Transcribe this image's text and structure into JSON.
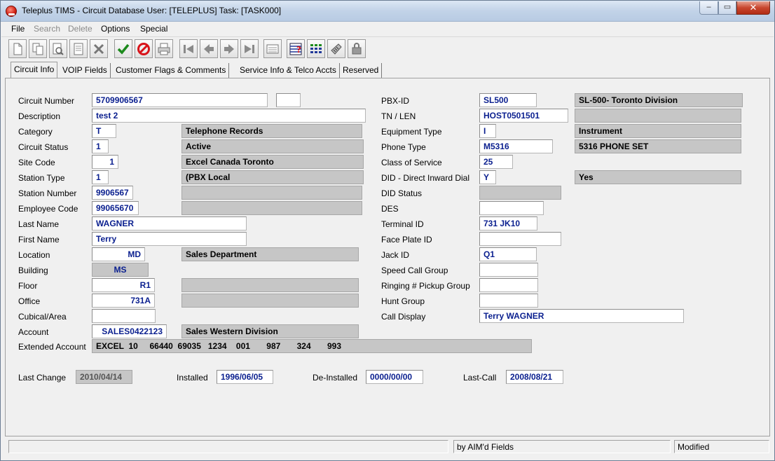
{
  "window": {
    "title": "Teleplus TIMS - Circuit Database  User: [TELEPLUS]  Task: [TASK000]",
    "minimize": "‒",
    "maximize": "▭",
    "close": "✕"
  },
  "menu": [
    "File",
    "Search",
    "Delete",
    "Options",
    "Special"
  ],
  "toolbar": {
    "icons": [
      "new-icon",
      "copy-icon",
      "find-icon",
      "print-preview-icon",
      "delete-icon",
      "accept-icon",
      "cancel-icon",
      "printer-icon",
      "first-record-icon",
      "previous-record-icon",
      "next-record-icon",
      "last-record-icon",
      "list-icon",
      "query-icon",
      "grid-icon",
      "phone-icon",
      "lock-icon"
    ],
    "colors": {
      "accept": "#1c8a1c",
      "cancel": "#d8131a",
      "nav": "#7a7a7a"
    }
  },
  "tabs": [
    "Circuit Info",
    "VOIP Fields",
    "Customer Flags & Comments",
    "Service Info & Telco Accts",
    "Reserved"
  ],
  "left": {
    "circuit_number": {
      "label": "Circuit Number",
      "value": "5709906567",
      "extra": ""
    },
    "description": {
      "label": "Description",
      "value": "test 2"
    },
    "category": {
      "label": "Category",
      "value": "T",
      "desc": "Telephone Records"
    },
    "circuit_status": {
      "label": "Circuit Status",
      "value": "1",
      "desc": "Active"
    },
    "site_code": {
      "label": "Site Code",
      "value": "1",
      "desc": "Excel Canada Toronto"
    },
    "station_type": {
      "label": "Station Type",
      "value": "1",
      "desc": "(PBX Local"
    },
    "station_number": {
      "label": "Station Number",
      "value": "9906567",
      "desc": ""
    },
    "employee_code": {
      "label": "Employee Code",
      "value": "99065670",
      "desc": ""
    },
    "last_name": {
      "label": "Last Name",
      "value": "WAGNER"
    },
    "first_name": {
      "label": "First Name",
      "value": "Terry"
    },
    "location": {
      "label": "Location",
      "value": "MD",
      "desc": "Sales Department"
    },
    "building": {
      "label": "Building",
      "value": "MS"
    },
    "floor": {
      "label": "Floor",
      "value": "R1",
      "desc": ""
    },
    "office": {
      "label": "Office",
      "value": "731A",
      "desc": ""
    },
    "cubical": {
      "label": "Cubical/Area",
      "value": ""
    },
    "account": {
      "label": "Account",
      "value": "SALES0422123",
      "desc": "Sales Western Division"
    },
    "extended_account": {
      "label": "Extended Account",
      "value": "EXCEL  10     66440  69035   1234    001       987       324       993"
    }
  },
  "right": {
    "pbx_id": {
      "label": "PBX-ID",
      "value": "SL500",
      "desc": "SL-500- Toronto Division"
    },
    "tn_len": {
      "label": "TN / LEN",
      "value": "HOST0501501",
      "desc": ""
    },
    "equipment_type": {
      "label": "Equipment Type",
      "value": "I",
      "desc": "Instrument"
    },
    "phone_type": {
      "label": "Phone Type",
      "value": "M5316",
      "desc": "5316 PHONE SET"
    },
    "class_of_service": {
      "label": "Class of Service",
      "value": "25"
    },
    "did": {
      "label": "DID - Direct Inward Dial",
      "value": "Y",
      "desc": "Yes"
    },
    "did_status": {
      "label": "DID Status",
      "value": ""
    },
    "des": {
      "label": "DES",
      "value": ""
    },
    "terminal_id": {
      "label": "Terminal ID",
      "value": "731 JK10"
    },
    "face_plate_id": {
      "label": "Face Plate ID",
      "value": ""
    },
    "jack_id": {
      "label": "Jack ID",
      "value": "Q1"
    },
    "speed_call_group": {
      "label": "Speed Call Group",
      "value": ""
    },
    "ringing_pickup_group": {
      "label": "Ringing # Pickup Group",
      "value": ""
    },
    "hunt_group": {
      "label": "Hunt  Group",
      "value": ""
    },
    "call_display": {
      "label": "Call Display",
      "value": "Terry WAGNER"
    }
  },
  "dates": {
    "last_change": {
      "label": "Last Change",
      "value": "2010/04/14"
    },
    "installed": {
      "label": "Installed",
      "value": "1996/06/05"
    },
    "de_installed": {
      "label": "De-Installed",
      "value": "0000/00/00"
    },
    "last_call": {
      "label": "Last-Call",
      "value": "2008/08/21"
    }
  },
  "status": {
    "message": "",
    "fields_info": "by AIM'd Fields",
    "state": "Modified"
  }
}
